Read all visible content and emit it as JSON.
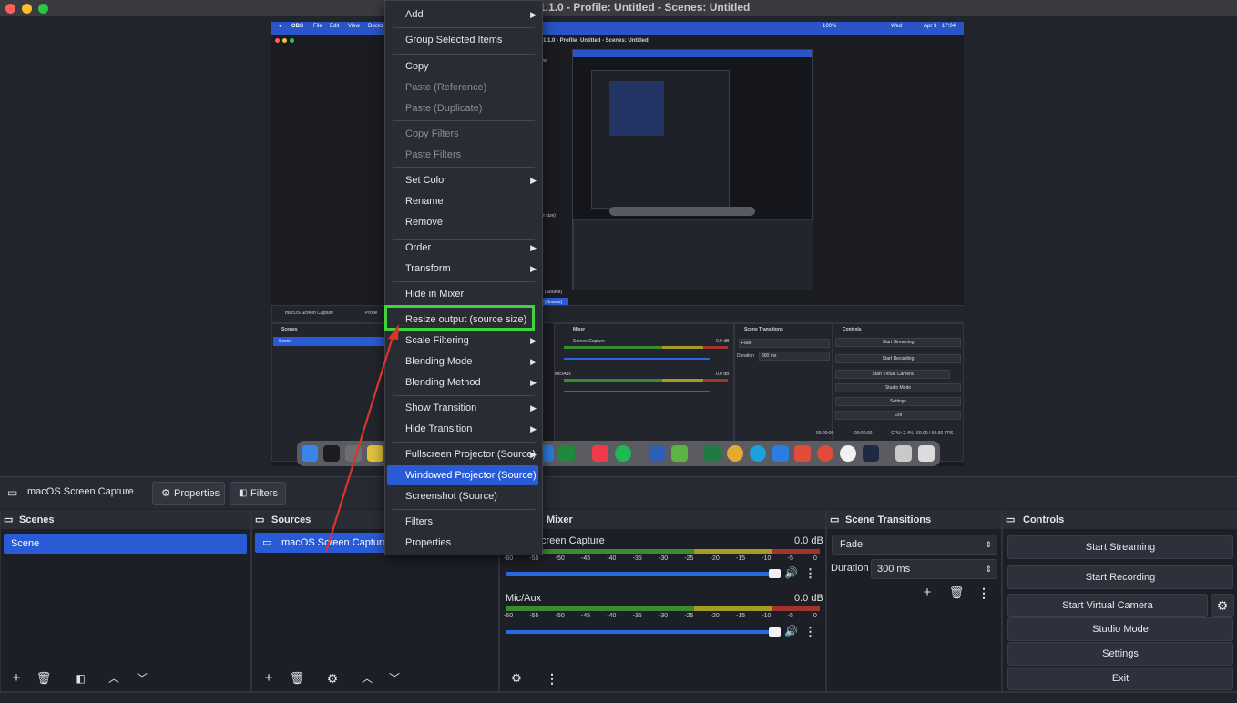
{
  "window": {
    "title_visible": "1.1.0 - Profile: Untitled - Scenes: Untitled"
  },
  "mini": {
    "menu": [
      "OBS",
      "File",
      "Edit",
      "View",
      "Docks"
    ],
    "status_right": [
      "100%",
      "Wed",
      "Apr 3",
      "17:04"
    ],
    "title": "1.1.0 - Profile: Untitled - Scenes: Untitled",
    "source_name": "macOS Screen Capture",
    "properties": "Prope",
    "scenes_header": "Scenes",
    "scene_item": "Scene",
    "mixer_header": "Mixer",
    "mixer_ch1": "Screen Capture",
    "mixer_ch2": "Mic/Aux",
    "db": "0.0 dB",
    "transitions_header": "Scene Transitions",
    "fade": "Fade",
    "duration_label": "Duration",
    "duration_value": "300 ms",
    "controls_header": "Controls",
    "controls": [
      "Start Streaming",
      "Start Recording",
      "Start Virtual Camera",
      "Studio Mode",
      "Settings",
      "Exit"
    ],
    "status_times": [
      "00:00:00",
      "00:00:00"
    ],
    "cpu": "CPU: 2.4%",
    "fps": "60.00 / 60.00 FPS",
    "partial_labels": [
      "ms",
      "rce size)",
      "r (Source)",
      "r (Source)"
    ]
  },
  "source_toolbar": {
    "source_name": "macOS Screen Capture",
    "properties": "Properties",
    "filters": "Filters"
  },
  "scenes": {
    "header": "Scenes",
    "items": [
      "Scene"
    ]
  },
  "sources": {
    "header": "Sources",
    "items": [
      "macOS Screen Capture"
    ]
  },
  "mixer": {
    "header": "Mixer",
    "channels": [
      {
        "name": "creen Capture",
        "db": "0.0 dB"
      },
      {
        "name": "Mic/Aux",
        "db": "0.0 dB"
      }
    ],
    "ticks": [
      "-60",
      "-55",
      "-50",
      "-45",
      "-40",
      "-35",
      "-30",
      "-25",
      "-20",
      "-15",
      "-10",
      "-5",
      "0"
    ],
    "volume": 0.95
  },
  "transitions": {
    "header": "Scene Transitions",
    "selected": "Fade",
    "duration_label": "Duration",
    "duration_value": "300 ms"
  },
  "controls": {
    "header": "Controls",
    "start_streaming": "Start Streaming",
    "start_recording": "Start Recording",
    "start_virtual_camera": "Start Virtual Camera",
    "studio_mode": "Studio Mode",
    "settings": "Settings",
    "exit": "Exit"
  },
  "context_menu": {
    "items": [
      {
        "label": "Add",
        "submenu": true,
        "disabled": false
      },
      {
        "label": "Group Selected Items",
        "submenu": false,
        "disabled": false
      },
      {
        "label": "Copy",
        "submenu": false,
        "disabled": false
      },
      {
        "label": "Paste (Reference)",
        "submenu": false,
        "disabled": true
      },
      {
        "label": "Paste (Duplicate)",
        "submenu": false,
        "disabled": true
      },
      {
        "label": "Copy Filters",
        "submenu": false,
        "disabled": true
      },
      {
        "label": "Paste Filters",
        "submenu": false,
        "disabled": true
      },
      {
        "label": "Set Color",
        "submenu": true,
        "disabled": false
      },
      {
        "label": "Rename",
        "submenu": false,
        "disabled": false
      },
      {
        "label": "Remove",
        "submenu": false,
        "disabled": false
      },
      {
        "label": "Order",
        "submenu": true,
        "disabled": false
      },
      {
        "label": "Transform",
        "submenu": true,
        "disabled": false
      },
      {
        "label": "Hide in Mixer",
        "submenu": false,
        "disabled": false
      },
      {
        "label": "Resize output (source size)",
        "submenu": false,
        "disabled": false
      },
      {
        "label": "Scale Filtering",
        "submenu": true,
        "disabled": false
      },
      {
        "label": "Blending Mode",
        "submenu": true,
        "disabled": false
      },
      {
        "label": "Blending Method",
        "submenu": true,
        "disabled": false
      },
      {
        "label": "Show Transition",
        "submenu": true,
        "disabled": false
      },
      {
        "label": "Hide Transition",
        "submenu": true,
        "disabled": false
      },
      {
        "label": "Fullscreen Projector (Source)",
        "submenu": true,
        "disabled": false
      },
      {
        "label": "Windowed Projector (Source)",
        "submenu": false,
        "disabled": false,
        "highlighted": true
      },
      {
        "label": "Screenshot (Source)",
        "submenu": false,
        "disabled": false
      },
      {
        "label": "Filters",
        "submenu": false,
        "disabled": false
      },
      {
        "label": "Properties",
        "submenu": false,
        "disabled": false
      }
    ]
  },
  "colors": {
    "accent": "#2a5bd7",
    "highlight_box": "#3ed33d",
    "annotation_arrow": "#d9352a"
  },
  "icons": [
    "monitor-icon",
    "gear-icon",
    "filter-icon",
    "plus-icon",
    "trash-icon",
    "chevron-up-icon",
    "chevron-down-icon",
    "speaker-icon",
    "kebab-icon",
    "mixer-settings-icon"
  ]
}
